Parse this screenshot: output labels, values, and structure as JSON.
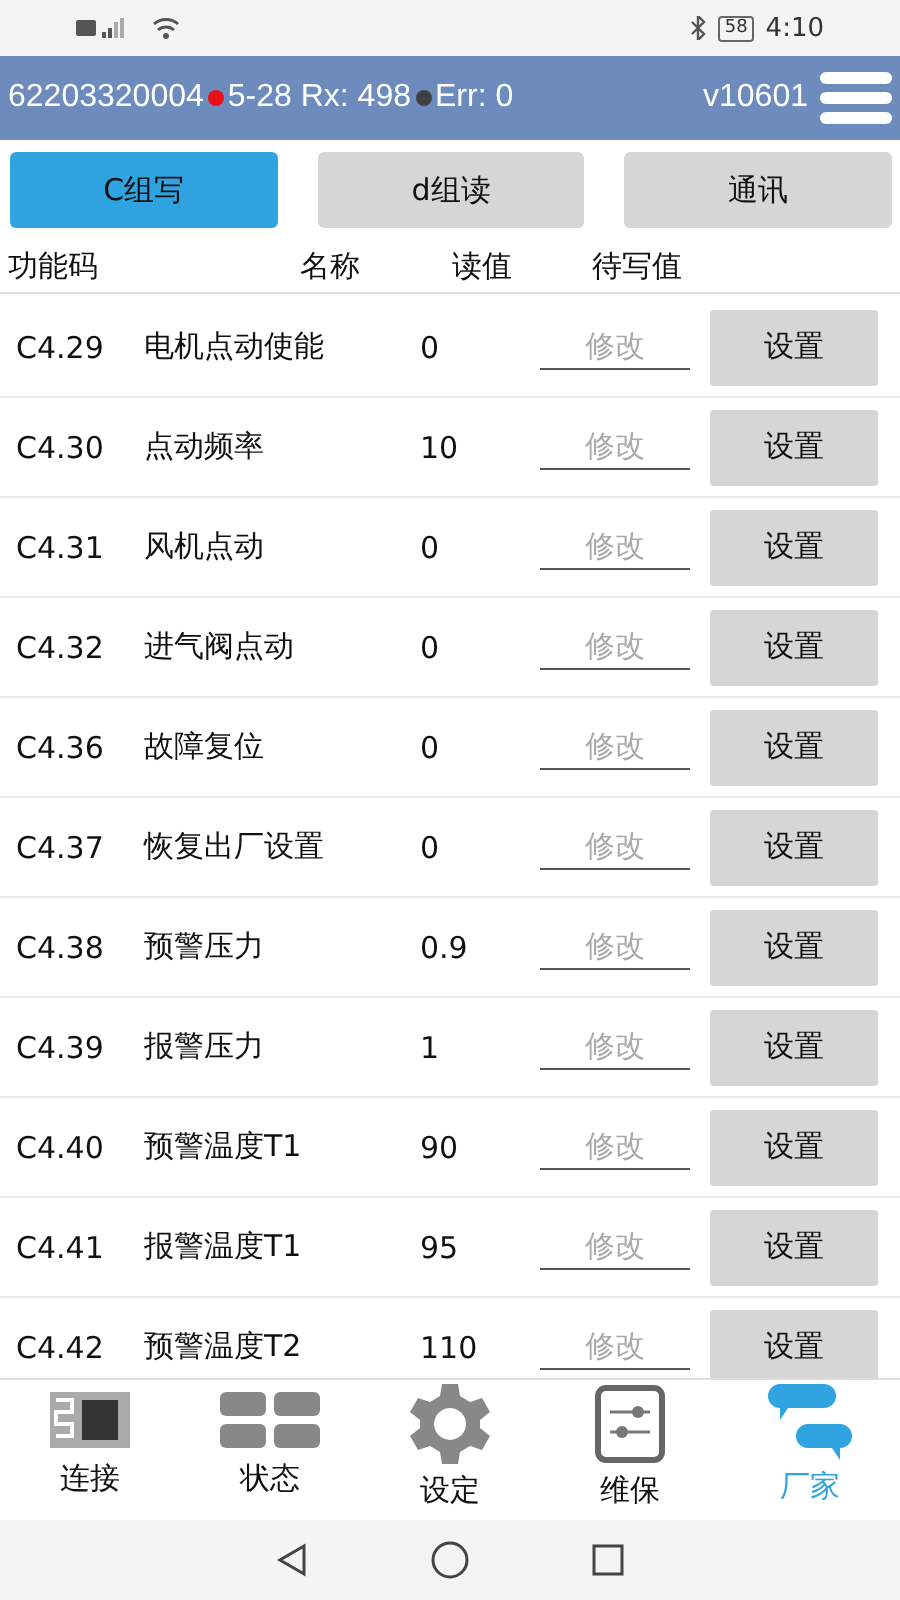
{
  "status_bar": {
    "battery": "58",
    "time": "4:10"
  },
  "header": {
    "device_id": "62203320004",
    "indicators": [
      {
        "color": "#e8101a",
        "text": "5-28 Rx: 498"
      },
      {
        "color": "#404040",
        "text": "Err: 0"
      }
    ],
    "version": "v10601"
  },
  "tabs": [
    {
      "label": "C组写",
      "selected": true
    },
    {
      "label": "d组读",
      "selected": false
    },
    {
      "label": "通讯",
      "selected": false
    }
  ],
  "table": {
    "columns": [
      "功能码",
      "名称",
      "读值",
      "待写值"
    ],
    "rows": [
      {
        "code": "C4.29",
        "name": "电机点动使能",
        "value": "0",
        "placeholder": "修改",
        "button": "设置"
      },
      {
        "code": "C4.30",
        "name": "点动频率",
        "value": "10",
        "placeholder": "修改",
        "button": "设置"
      },
      {
        "code": "C4.31",
        "name": "风机点动",
        "value": "0",
        "placeholder": "修改",
        "button": "设置"
      },
      {
        "code": "C4.32",
        "name": "进气阀点动",
        "value": "0",
        "placeholder": "修改",
        "button": "设置"
      },
      {
        "code": "C4.36",
        "name": "故障复位",
        "value": "0",
        "placeholder": "修改",
        "button": "设置"
      },
      {
        "code": "C4.37",
        "name": "恢复出厂设置",
        "value": "0",
        "placeholder": "修改",
        "button": "设置"
      },
      {
        "code": "C4.38",
        "name": "预警压力",
        "value": "0.9",
        "placeholder": "修改",
        "button": "设置"
      },
      {
        "code": "C4.39",
        "name": "报警压力",
        "value": "1",
        "placeholder": "修改",
        "button": "设置"
      },
      {
        "code": "C4.40",
        "name": "预警温度T1",
        "value": "90",
        "placeholder": "修改",
        "button": "设置"
      },
      {
        "code": "C4.41",
        "name": "报警温度T1",
        "value": "95",
        "placeholder": "修改",
        "button": "设置"
      },
      {
        "code": "C4.42",
        "name": "预警温度T2",
        "value": "110",
        "placeholder": "修改",
        "button": "设置"
      }
    ]
  },
  "bottom_nav": [
    {
      "kind": "connect",
      "label": "连接",
      "selected": false
    },
    {
      "kind": "status",
      "label": "状态",
      "selected": false
    },
    {
      "kind": "settings",
      "label": "设定",
      "selected": false
    },
    {
      "kind": "maintenance",
      "label": "维保",
      "selected": false
    },
    {
      "kind": "factory",
      "label": "厂家",
      "selected": true
    }
  ]
}
